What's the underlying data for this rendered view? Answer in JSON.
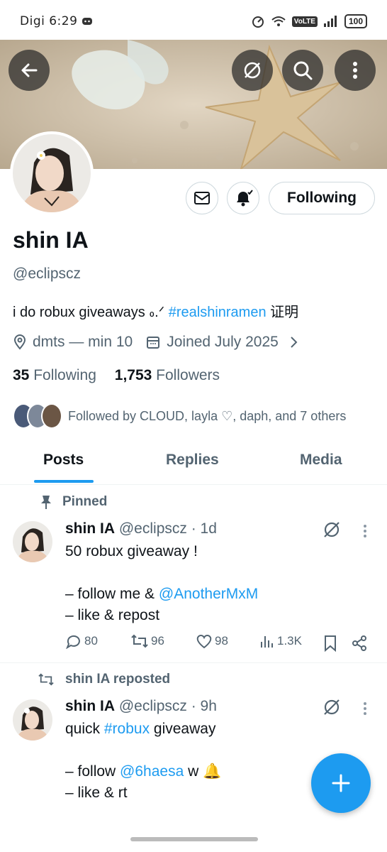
{
  "status_bar": {
    "left_text": "Digi 6:29",
    "volte": "VoLTE",
    "battery": "100"
  },
  "header_buttons": {
    "back": "back-arrow-icon",
    "grok": "grok-icon",
    "search": "search-icon",
    "more": "more-vertical-icon"
  },
  "profile": {
    "name": "shin IA",
    "handle": "@eclipscz",
    "bio_text": "i do robux giveaways ៰.ᐟ ",
    "bio_hashtag": "#realshinramen",
    "bio_suffix": " 证明",
    "location": "dmts — min 10",
    "joined": "Joined July 2025",
    "following_count": "35",
    "following_label": "Following",
    "followers_count": "1,753",
    "followers_label": "Followers",
    "followed_by": "Followed by CLOUD, layla ♡, daph, and 7 others",
    "following_button": "Following"
  },
  "tabs": [
    {
      "label": "Posts"
    },
    {
      "label": "Replies"
    },
    {
      "label": "Media"
    }
  ],
  "posts": [
    {
      "context": "Pinned",
      "name": "shin IA",
      "handle": "@eclipscz",
      "time": "· 1d",
      "line1": "50 robux giveaway !",
      "line2_prefix": "– follow me & ",
      "line2_mention": "@AnotherMxM",
      "line3": "– like & repost",
      "replies": "80",
      "reposts": "96",
      "likes": "98",
      "views": "1.3K"
    },
    {
      "context": "shin IA reposted",
      "name": "shin IA",
      "handle": "@eclipscz",
      "time": "· 9h",
      "line1_prefix": "quick ",
      "line1_hashtag": "#robux",
      "line1_suffix": " giveaway",
      "line2_prefix": "– follow ",
      "line2_mention": "@6haesa",
      "line2_suffix": " w 🔔",
      "line3": "– like & rt"
    }
  ],
  "colors": {
    "accent": "#1d9bf0",
    "text": "#0f1419",
    "muted": "#536471",
    "border": "#cfd9de"
  }
}
